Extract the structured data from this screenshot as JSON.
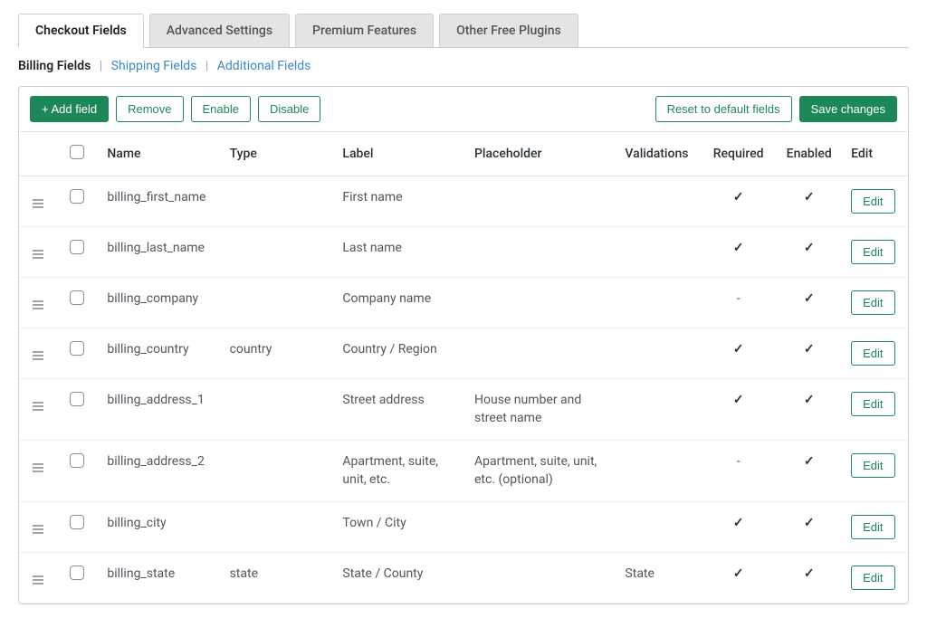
{
  "tabs": [
    {
      "label": "Checkout Fields",
      "active": true
    },
    {
      "label": "Advanced Settings",
      "active": false
    },
    {
      "label": "Premium Features",
      "active": false
    },
    {
      "label": "Other Free Plugins",
      "active": false
    }
  ],
  "subtabs": {
    "items": [
      {
        "label": "Billing Fields",
        "active": true
      },
      {
        "label": "Shipping Fields",
        "active": false
      },
      {
        "label": "Additional Fields",
        "active": false
      }
    ]
  },
  "toolbar": {
    "add": "+ Add field",
    "remove": "Remove",
    "enable": "Enable",
    "disable": "Disable",
    "reset": "Reset to default fields",
    "save": "Save changes"
  },
  "columns": {
    "name": "Name",
    "type": "Type",
    "label": "Label",
    "placeholder": "Placeholder",
    "validations": "Validations",
    "required": "Required",
    "enabled": "Enabled",
    "edit": "Edit"
  },
  "rows": [
    {
      "name": "billing_first_name",
      "type": "",
      "label": "First name",
      "placeholder": "",
      "validations": "",
      "required": true,
      "enabled": true
    },
    {
      "name": "billing_last_name",
      "type": "",
      "label": "Last name",
      "placeholder": "",
      "validations": "",
      "required": true,
      "enabled": true
    },
    {
      "name": "billing_company",
      "type": "",
      "label": "Company name",
      "placeholder": "",
      "validations": "",
      "required": false,
      "enabled": true
    },
    {
      "name": "billing_country",
      "type": "country",
      "label": "Country / Region",
      "placeholder": "",
      "validations": "",
      "required": true,
      "enabled": true
    },
    {
      "name": "billing_address_1",
      "type": "",
      "label": "Street address",
      "placeholder": "House number and street name",
      "validations": "",
      "required": true,
      "enabled": true
    },
    {
      "name": "billing_address_2",
      "type": "",
      "label": "Apartment, suite, unit, etc.",
      "placeholder": "Apartment, suite, unit, etc. (optional)",
      "validations": "",
      "required": false,
      "enabled": true
    },
    {
      "name": "billing_city",
      "type": "",
      "label": "Town / City",
      "placeholder": "",
      "validations": "",
      "required": true,
      "enabled": true
    },
    {
      "name": "billing_state",
      "type": "state",
      "label": "State / County",
      "placeholder": "",
      "validations": "State",
      "required": true,
      "enabled": true
    }
  ],
  "edit_label": "Edit"
}
